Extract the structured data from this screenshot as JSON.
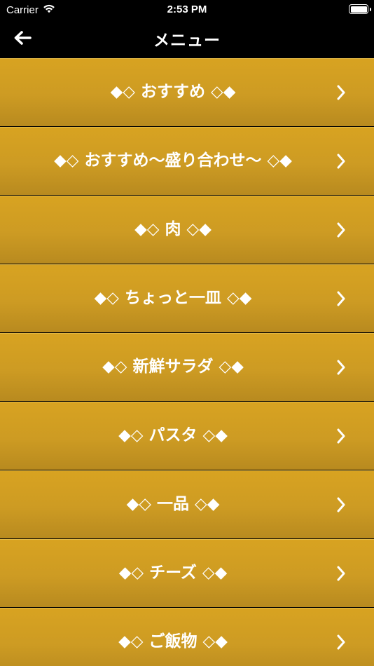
{
  "status_bar": {
    "carrier": "Carrier",
    "time": "2:53 PM",
    "battery_level": 1.0
  },
  "nav": {
    "title": "メニュー",
    "back_icon": "arrow-left-icon"
  },
  "menu": {
    "items": [
      {
        "label": "◆◇ おすすめ ◇◆"
      },
      {
        "label": "◆◇ おすすめ～盛り合わせ～ ◇◆"
      },
      {
        "label": "◆◇ 肉 ◇◆"
      },
      {
        "label": "◆◇ ちょっと一皿 ◇◆"
      },
      {
        "label": "◆◇ 新鮮サラダ ◇◆"
      },
      {
        "label": "◆◇ パスタ ◇◆"
      },
      {
        "label": "◆◇ 一品 ◇◆"
      },
      {
        "label": "◆◇ チーズ ◇◆"
      },
      {
        "label": "◆◇ ご飯物 ◇◆"
      }
    ],
    "chevron_icon": "chevron-right-icon"
  },
  "colors": {
    "background": "#000000",
    "item_gold": "#d1a023",
    "text": "#ffffff"
  }
}
